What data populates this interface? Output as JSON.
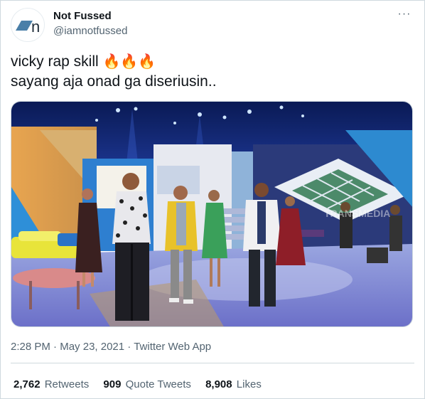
{
  "author": {
    "display_name": "Not Fussed",
    "handle": "@iamnotfussed",
    "avatar_icon": "nf-logo-icon",
    "avatar_letter": "n"
  },
  "more_icon": "more-options-icon",
  "more_glyph": "···",
  "tweet": {
    "line1": "vicky rap skill",
    "emojis": "🔥🔥🔥",
    "line2": "sayang aja onad ga diseriusin.."
  },
  "media": {
    "watermark": "TRANSMEDIA"
  },
  "meta": {
    "time": "2:28 PM",
    "separator1": " · ",
    "date": "May 23, 2021",
    "separator2": " · ",
    "source": "Twitter Web App"
  },
  "stats": {
    "retweets_count": "2,762",
    "retweets_label": "Retweets",
    "quotes_count": "909",
    "quotes_label": "Quote Tweets",
    "likes_count": "8,908",
    "likes_label": "Likes"
  },
  "colors": {
    "text": "#0f1419",
    "secondary": "#536471",
    "border": "#cfd9de",
    "logo_blue": "#4a7fa8"
  }
}
